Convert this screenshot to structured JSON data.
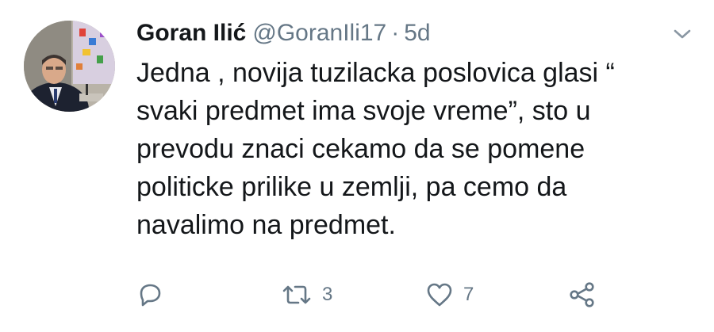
{
  "tweet": {
    "author": {
      "display_name": "Goran Ilić",
      "handle": "@GoranIli17",
      "separator": "·",
      "time": "5d"
    },
    "text": "Jedna , novija tuzilacka poslovica glasi “\nsvaki predmet ima svoje vreme”, sto u\nprevodu znaci cekamo da se pomene\npoliticke prilike u zemlji, pa cemo da\nnavalimo na predmet.",
    "actions": {
      "reply_icon": "reply-icon",
      "retweet_icon": "retweet-icon",
      "retweet_count": "3",
      "like_icon": "heart-icon",
      "like_count": "7",
      "share_icon": "share-icon"
    },
    "menu_icon": "chevron-down-icon",
    "colors": {
      "text": "#14171a",
      "secondary": "#657786",
      "background": "#ffffff"
    }
  }
}
